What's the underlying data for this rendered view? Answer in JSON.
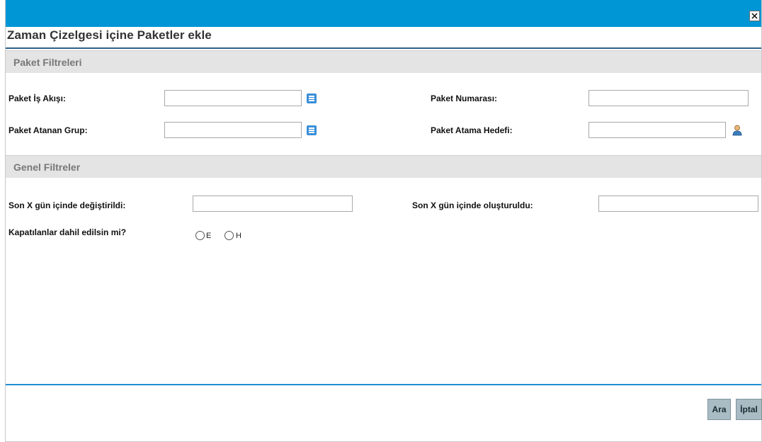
{
  "dialog": {
    "title": "Zaman Çizelgesi içine Paketler ekle",
    "close_icon": "close-icon"
  },
  "package_filters": {
    "header": "Paket Filtreleri",
    "workflow_label": "Paket İş Akışı:",
    "workflow_value": "",
    "package_number_label": "Paket Numarası:",
    "package_number_value": "",
    "assigned_group_label": "Paket Atanan Grup:",
    "assigned_group_value": "",
    "assignee_label": "Paket Atama Hedefi:",
    "assignee_value": ""
  },
  "general_filters": {
    "header": "Genel Filtreler",
    "modified_label": "Son X gün içinde değiştirildi:",
    "modified_value": "",
    "created_label": "Son X gün içinde oluşturuldu:",
    "created_value": "",
    "include_closed_label": "Kapatılanlar dahil edilsin mi?",
    "option_yes": "E",
    "option_no": "H"
  },
  "buttons": {
    "search": "Ara",
    "cancel": "İptal"
  },
  "colors": {
    "topbar": "#0096d6",
    "section_header": "#e4e4e4",
    "button": "#a9bcc4",
    "accent_rule": "#1e8fd2"
  }
}
